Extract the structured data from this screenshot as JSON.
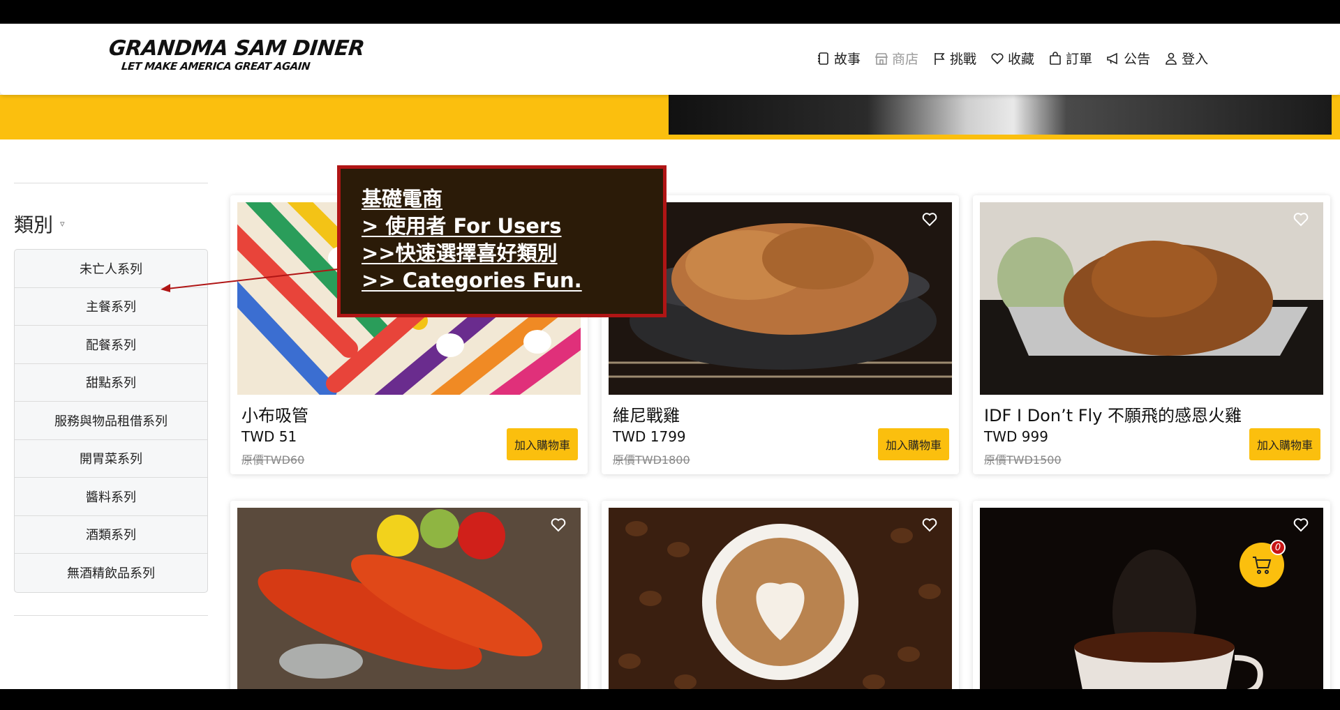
{
  "header": {
    "logo_title": "GRANDMA SAM DINER",
    "logo_subtitle": "LET MAKE AMERICA GREAT AGAIN",
    "nav": [
      {
        "label": "故事",
        "icon": "notebook-icon",
        "active": true
      },
      {
        "label": "商店",
        "icon": "store-icon",
        "active": false
      },
      {
        "label": "挑戰",
        "icon": "flag-icon",
        "active": true
      },
      {
        "label": "收藏",
        "icon": "heart-icon",
        "active": true
      },
      {
        "label": "訂單",
        "icon": "bag-icon",
        "active": true
      },
      {
        "label": "公告",
        "icon": "megaphone-icon",
        "active": true
      },
      {
        "label": "登入",
        "icon": "user-icon",
        "active": true
      }
    ]
  },
  "sidebar": {
    "title": "類別",
    "title_icon": "▿",
    "categories": [
      "未亡人系列",
      "主餐系列",
      "配餐系列",
      "甜點系列",
      "服務與物品租借系列",
      "開胃菜系列",
      "醬料系列",
      "酒類系列",
      "無酒精飲品系列"
    ]
  },
  "tutorial": {
    "lines": [
      "基礎電商",
      "> 使用者 For Users",
      ">>快速選擇喜好類別",
      ">> Categories Fun."
    ]
  },
  "products": [
    {
      "name": "小布吸管",
      "price": "TWD 51",
      "original": "原價TWD60",
      "button": "加入購物車"
    },
    {
      "name": "維尼戰雞",
      "price": "TWD 1799",
      "original": "原價TWD1800",
      "button": "加入購物車"
    },
    {
      "name": "IDF I Don’t Fly 不願飛的感恩火雞",
      "price": "TWD 999",
      "original": "原價TWD1500",
      "button": "加入購物車"
    },
    {
      "name": "",
      "price": "",
      "original": "",
      "button": ""
    },
    {
      "name": "",
      "price": "",
      "original": "",
      "button": ""
    },
    {
      "name": "",
      "price": "",
      "original": "",
      "button": ""
    }
  ],
  "cart": {
    "count": "0"
  },
  "colors": {
    "accent": "#fbbf0e",
    "tip_bg": "#2b1b08",
    "tip_border": "#b01515",
    "badge": "#c81515"
  }
}
